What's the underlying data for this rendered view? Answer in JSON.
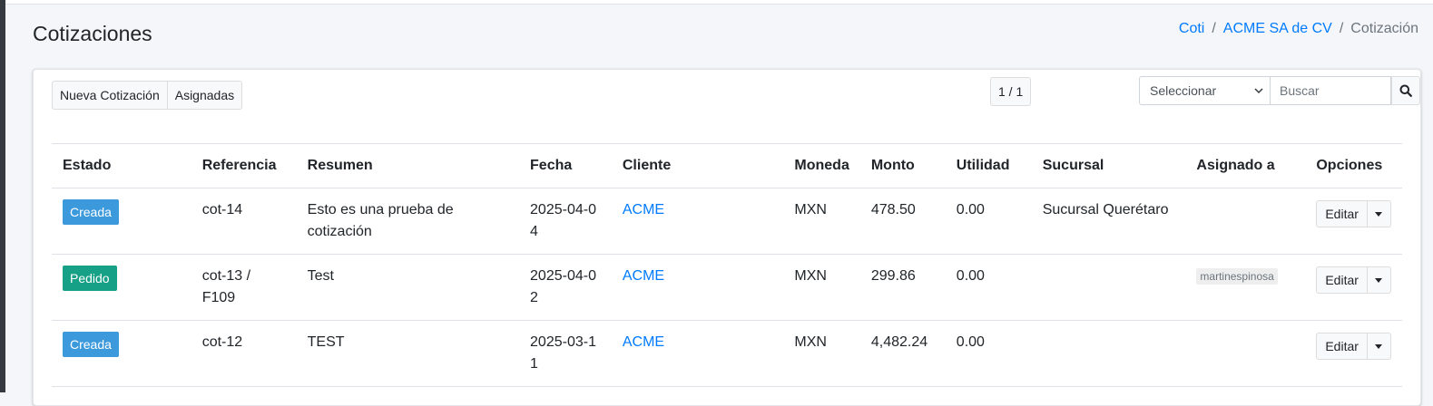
{
  "header": {
    "title": "Cotizaciones",
    "breadcrumb": [
      "Coti",
      "ACME SA de CV",
      "Cotización"
    ]
  },
  "toolbar": {
    "new_label": "Nueva Cotización",
    "assigned_label": "Asignadas",
    "pager": "1 / 1",
    "select_value": "Seleccionar",
    "search_placeholder": "Buscar"
  },
  "table": {
    "columns": [
      "Estado",
      "Referencia",
      "Resumen",
      "Fecha",
      "Cliente",
      "Moneda",
      "Monto",
      "Utilidad",
      "Sucursal",
      "Asignado a",
      "Opciones"
    ],
    "rows": [
      {
        "estado": "Creada",
        "estado_color": "#3c99dc",
        "referencia": "cot-14",
        "resumen": "Esto es una prueba de cotización",
        "fecha": "2025-04-04",
        "cliente": "ACME",
        "moneda": "MXN",
        "monto": "478.50",
        "utilidad": "0.00",
        "sucursal": "Sucursal Querétaro",
        "asignado": "",
        "edit_label": "Editar"
      },
      {
        "estado": "Pedido",
        "estado_color": "#16a085",
        "referencia": "cot-13 / F109",
        "resumen": "Test",
        "fecha": "2025-04-02",
        "cliente": "ACME",
        "moneda": "MXN",
        "monto": "299.86",
        "utilidad": "0.00",
        "sucursal": "",
        "asignado": "martinespinosa",
        "edit_label": "Editar"
      },
      {
        "estado": "Creada",
        "estado_color": "#3c99dc",
        "referencia": "cot-12",
        "resumen": "TEST",
        "fecha": "2025-03-11",
        "cliente": "ACME",
        "moneda": "MXN",
        "monto": "4,482.24",
        "utilidad": "0.00",
        "sucursal": "",
        "asignado": "",
        "edit_label": "Editar"
      }
    ]
  },
  "colors": {
    "link": "#007bff",
    "creada": "#3c99dc",
    "pedido": "#16a085"
  }
}
